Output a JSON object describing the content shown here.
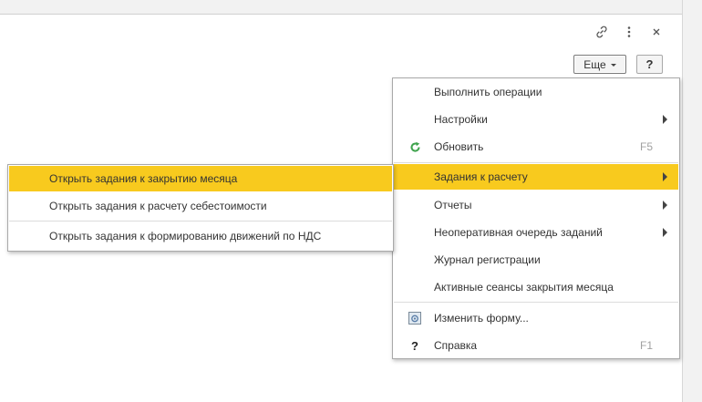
{
  "toolbar": {
    "more_label": "Еще",
    "help_label": "?"
  },
  "menu": {
    "items": [
      {
        "label": "Выполнить операции"
      },
      {
        "label": "Настройки"
      },
      {
        "label": "Обновить",
        "shortcut": "F5"
      },
      {
        "label": "Задания к расчету"
      },
      {
        "label": "Отчеты"
      },
      {
        "label": "Неоперативная очередь заданий"
      },
      {
        "label": "Журнал регистрации"
      },
      {
        "label": "Активные сеансы закрытия месяца"
      },
      {
        "label": "Изменить форму..."
      },
      {
        "label": "Справка",
        "shortcut": "F1"
      }
    ]
  },
  "submenu": {
    "items": [
      {
        "label": "Открыть задания к закрытию месяца"
      },
      {
        "label": "Открыть задания к расчету себестоимости"
      },
      {
        "label": "Открыть задания к формированию движений по НДС"
      }
    ]
  },
  "colors": {
    "highlight": "#f8ca1e",
    "refresh_icon": "#3fa34d"
  }
}
